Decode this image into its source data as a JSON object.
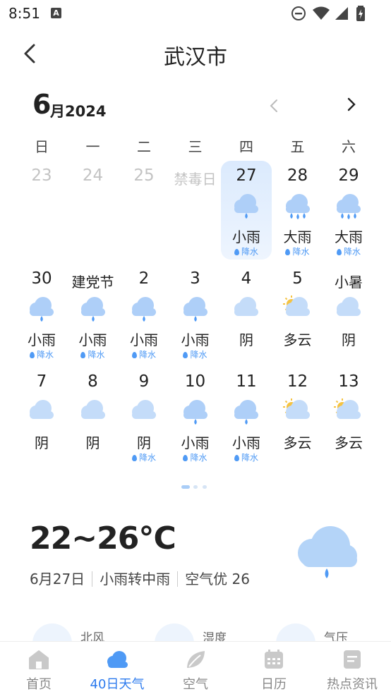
{
  "status_bar": {
    "time": "8:51",
    "app_badge": "A"
  },
  "header": {
    "title": "武汉市"
  },
  "month": {
    "number": "6",
    "unit": "月2024"
  },
  "weekdays": [
    "日",
    "一",
    "二",
    "三",
    "四",
    "五",
    "六"
  ],
  "days": [
    {
      "day": "23",
      "past": true
    },
    {
      "day": "24",
      "past": true
    },
    {
      "day": "25",
      "past": true
    },
    {
      "day": "禁毒日",
      "past": true,
      "festival": true
    },
    {
      "day": "27",
      "icon": "light-rain-icon",
      "weather": "小雨",
      "precip": "降水",
      "selected": true
    },
    {
      "day": "28",
      "icon": "heavy-rain-icon",
      "weather": "大雨",
      "precip": "降水"
    },
    {
      "day": "29",
      "icon": "heavy-rain-icon",
      "weather": "大雨",
      "precip": "降水"
    },
    {
      "day": "30",
      "icon": "light-rain-icon",
      "weather": "小雨",
      "precip": "降水"
    },
    {
      "day": "建党节",
      "festival": true,
      "icon": "light-rain-icon",
      "weather": "小雨",
      "precip": "降水"
    },
    {
      "day": "2",
      "icon": "light-rain-icon",
      "weather": "小雨",
      "precip": "降水"
    },
    {
      "day": "3",
      "icon": "light-rain-icon",
      "weather": "小雨",
      "precip": "降水"
    },
    {
      "day": "4",
      "icon": "cloudy-icon",
      "weather": "阴"
    },
    {
      "day": "5",
      "icon": "partly-cloudy-icon",
      "weather": "多云"
    },
    {
      "day": "小暑",
      "festival": true,
      "icon": "cloudy-icon",
      "weather": "阴"
    },
    {
      "day": "7",
      "icon": "cloudy-icon",
      "weather": "阴"
    },
    {
      "day": "8",
      "icon": "cloudy-icon",
      "weather": "阴"
    },
    {
      "day": "9",
      "icon": "cloudy-icon",
      "weather": "阴",
      "precip": "降水"
    },
    {
      "day": "10",
      "icon": "light-rain-icon",
      "weather": "小雨",
      "precip": "降水"
    },
    {
      "day": "11",
      "icon": "light-rain-icon",
      "weather": "小雨",
      "precip": "降水"
    },
    {
      "day": "12",
      "icon": "partly-cloudy-icon",
      "weather": "多云"
    },
    {
      "day": "13",
      "icon": "partly-cloudy-icon",
      "weather": "多云"
    }
  ],
  "current": {
    "temp": "22~26℃",
    "date": "6月27日",
    "weather": "小雨转中雨",
    "air": "空气优 26",
    "icon": "rain-cloud-icon"
  },
  "details": [
    {
      "label": "北风",
      "icon": "wind-icon"
    },
    {
      "label": "湿度",
      "icon": "humidity-icon"
    },
    {
      "label": "气压",
      "icon": "pressure-icon"
    }
  ],
  "nav": [
    {
      "label": "首页",
      "icon": "home-icon",
      "active": false
    },
    {
      "label": "40日天气",
      "icon": "weather-icon",
      "active": true
    },
    {
      "label": "空气",
      "icon": "leaf-icon",
      "active": false
    },
    {
      "label": "日历",
      "icon": "calendar-icon",
      "active": false
    },
    {
      "label": "热点资讯",
      "icon": "news-icon",
      "active": false
    }
  ],
  "colors": {
    "accent": "#2d7bee",
    "precip": "#4f9af5",
    "cloud": "#a9cdf7",
    "sun": "#f5c342",
    "selected_bg": "#dbeafd"
  }
}
